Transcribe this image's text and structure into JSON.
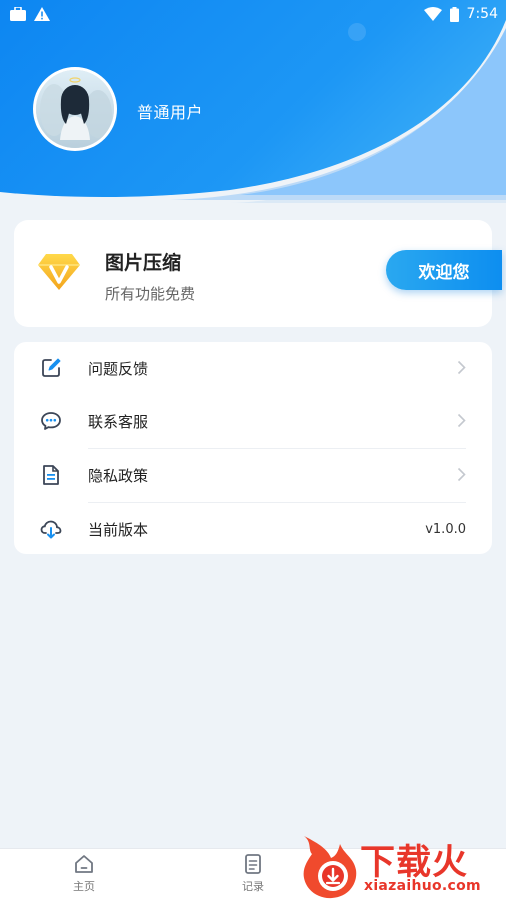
{
  "status_bar": {
    "time": "7:54",
    "icons": [
      "briefcase-icon",
      "warning-icon",
      "wifi-icon",
      "battery-icon"
    ]
  },
  "profile": {
    "user_name": "普通用户"
  },
  "promo": {
    "title": "图片压缩",
    "subtitle": "所有功能免费",
    "welcome_button": "欢迎您",
    "accent_color": "#0d8ef0"
  },
  "menu": {
    "items": [
      {
        "label": "问题反馈",
        "icon": "edit-icon"
      },
      {
        "label": "联系客服",
        "icon": "chat-icon"
      },
      {
        "label": "隐私政策",
        "icon": "document-icon"
      },
      {
        "label": "当前版本",
        "icon": "cloud-download-icon",
        "value": "v1.0.0"
      }
    ]
  },
  "bottom_nav": {
    "items": [
      {
        "label": "主页",
        "icon": "home-icon"
      },
      {
        "label": "记录",
        "icon": "record-icon"
      }
    ]
  },
  "watermark": {
    "title": "下载火",
    "url": "xiazaihuo.com"
  }
}
